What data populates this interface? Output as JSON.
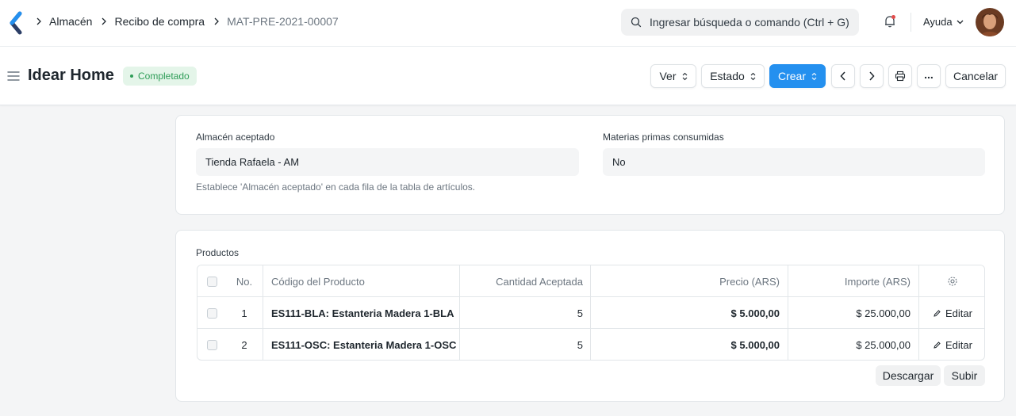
{
  "navbar": {
    "breadcrumbs": [
      "Almacén",
      "Recibo de compra",
      "MAT-PRE-2021-00007"
    ],
    "search_placeholder": "Ingresar búsqueda o comando (Ctrl + G)",
    "help_label": "Ayuda"
  },
  "page": {
    "title": "Idear Home",
    "status": "Completado",
    "actions": {
      "view": "Ver",
      "status": "Estado",
      "create": "Crear",
      "cancel": "Cancelar",
      "more": "..."
    }
  },
  "warehouse_section": {
    "accepted_label": "Almacén aceptado",
    "accepted_value": "Tienda Rafaela - AM",
    "accepted_help": "Establece 'Almacén aceptado' en cada fila de la tabla de artículos.",
    "raw_materials_label": "Materias primas consumidas",
    "raw_materials_value": "No"
  },
  "items_section": {
    "label": "Productos",
    "columns": [
      "No.",
      "Código del Producto",
      "Cantidad Aceptada",
      "Precio (ARS)",
      "Importe (ARS)"
    ],
    "rows": [
      {
        "no": "1",
        "code": "ES111-BLA: Estanteria Madera 1-BLA",
        "qty": "5",
        "price": "$ 5.000,00",
        "amount": "$ 25.000,00",
        "action": "Editar"
      },
      {
        "no": "2",
        "code": "ES111-OSC: Estanteria Madera 1-OSC",
        "qty": "5",
        "price": "$ 5.000,00",
        "amount": "$ 25.000,00",
        "action": "Editar"
      }
    ],
    "download_label": "Descargar",
    "upload_label": "Subir"
  },
  "colors": {
    "primary": "#2490ef",
    "status_green": "#2f9d58",
    "status_bg": "#e4f5e9"
  },
  "icons": [
    "app-logo-icon",
    "chevron-right-icon",
    "search-icon",
    "bell-icon",
    "chevron-down-icon",
    "hamburger-icon",
    "select-arrows-icon",
    "chevron-left-icon",
    "printer-icon",
    "more-icon",
    "gear-icon",
    "pencil-icon"
  ]
}
